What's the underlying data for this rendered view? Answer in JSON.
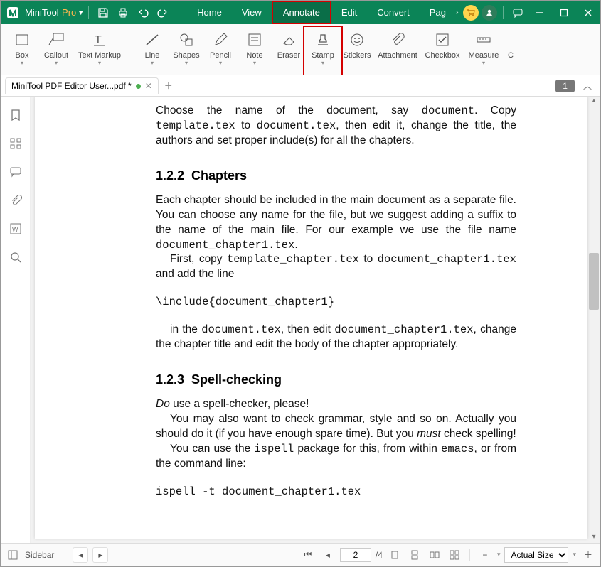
{
  "app": {
    "name": "MiniTool",
    "suffix": "-Pro"
  },
  "menu": {
    "home": "Home",
    "view": "View",
    "annotate": "Annotate",
    "edit": "Edit",
    "convert": "Convert",
    "page": "Pag"
  },
  "ribbon": {
    "box": "Box",
    "callout": "Callout",
    "textmarkup": "Text Markup",
    "line": "Line",
    "shapes": "Shapes",
    "pencil": "Pencil",
    "note": "Note",
    "eraser": "Eraser",
    "stamp": "Stamp",
    "stickers": "Stickers",
    "attachment": "Attachment",
    "checkbox": "Checkbox",
    "measure": "Measure",
    "cut": "C"
  },
  "doc": {
    "tabname": "MiniTool PDF Editor User...pdf *",
    "pagebadge": "1"
  },
  "content": {
    "p1a": "Choose the name of the document, say ",
    "p1code1": "document",
    "p1b": ". Copy ",
    "p1code2": "template.tex",
    "p1c": " to ",
    "p1code3": "document.tex",
    "p1d": ", then edit it, change the title, the authors and set proper include(s) for all the chapters.",
    "h122no": "1.2.2",
    "h122": "Chapters",
    "p2a": "Each chapter should be included in the main document as a separate file. You can choose any name for the file, but we suggest adding a suffix to the name of the main file. For our example we use the file name ",
    "p2code1": "document_chapter1.tex",
    "p2b": ".",
    "p3a": "First, copy ",
    "p3code1": "template_chapter.tex",
    "p3b": " to ",
    "p3code2": "document_chapter1.tex",
    "p3c": " and add the line",
    "code1": "\\include{document_chapter1}",
    "p4a": "in the ",
    "p4code1": "document.tex",
    "p4b": ", then edit ",
    "p4code2": "document_chapter1.tex",
    "p4c": ", change the chapter title and edit the body of the chapter appropriately.",
    "h123no": "1.2.3",
    "h123": "Spell-checking",
    "p5em": "Do",
    "p5a": " use a spell-checker, please!",
    "p6a": "You may also want to check grammar, style and so on. Actually you should do it (if you have enough spare time). But you ",
    "p6em": "must",
    "p6b": " check spelling!",
    "p7a": "You can use the ",
    "p7code1": "ispell",
    "p7b": " package for this, from within ",
    "p7code2": "emacs",
    "p7c": ", or from the command line:",
    "code2": "ispell -t document_chapter1.tex"
  },
  "status": {
    "sidebar": "Sidebar",
    "page_current": "2",
    "page_total": "/4",
    "zoom": "Actual Size"
  }
}
